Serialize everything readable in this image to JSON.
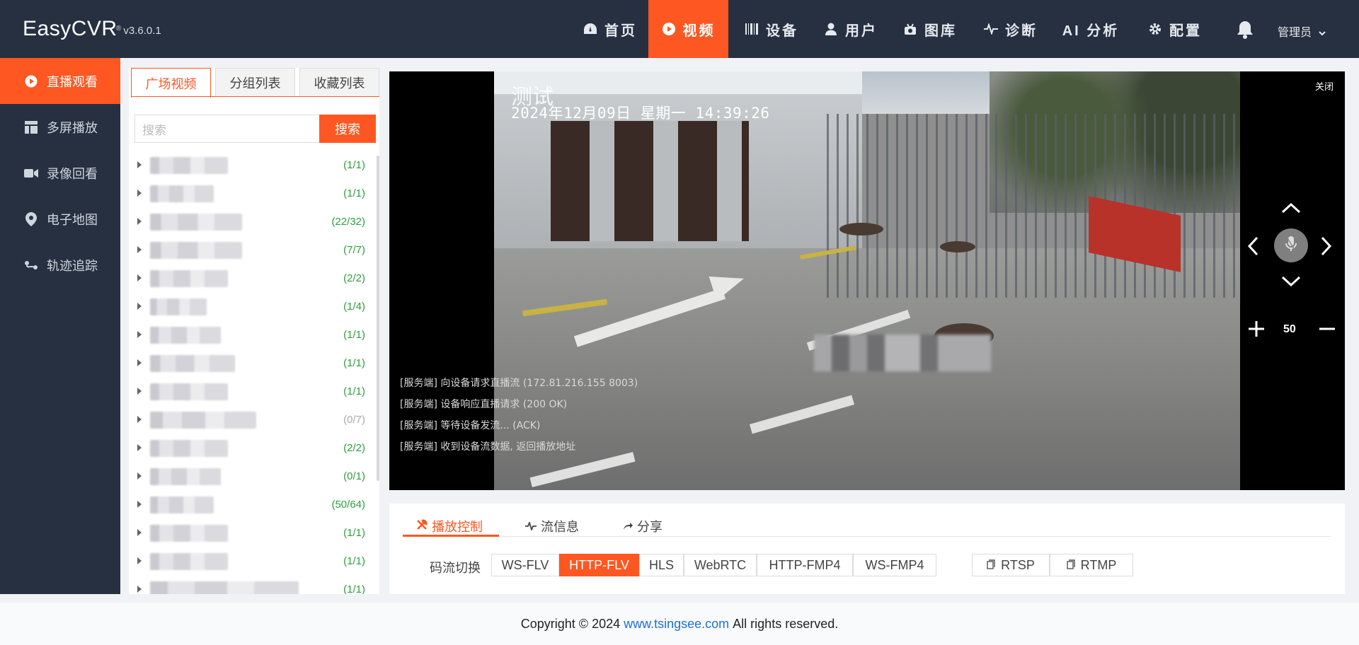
{
  "app": {
    "logo": "EasyCVR",
    "version_mark": "®",
    "version": "v3.6.0.1",
    "colors": {
      "accent": "#ff5722",
      "nav_bg": "#263040",
      "count_green": "#2e9e3e"
    }
  },
  "nav": {
    "items": [
      {
        "label": "首页",
        "icon": "dashboard-icon"
      },
      {
        "label": "视频",
        "icon": "play-circle-icon",
        "active": true
      },
      {
        "label": "设备",
        "icon": "barcode-icon"
      },
      {
        "label": "用户",
        "icon": "user-icon"
      },
      {
        "label": "图库",
        "icon": "camera-icon"
      },
      {
        "label": "诊断",
        "icon": "pulse-icon"
      },
      {
        "label": "AI 分析",
        "icon": ""
      },
      {
        "label": "配置",
        "icon": "gear-icon"
      }
    ],
    "user_label": "管理员"
  },
  "sidebar": {
    "items": [
      {
        "label": "直播观看",
        "icon": "play-circle-icon",
        "active": true
      },
      {
        "label": "多屏播放",
        "icon": "grid-layout-icon"
      },
      {
        "label": "录像回看",
        "icon": "video-camera-icon"
      },
      {
        "label": "电子地图",
        "icon": "map-pin-icon"
      },
      {
        "label": "轨迹追踪",
        "icon": "track-icon"
      }
    ]
  },
  "device_panel": {
    "tabs": [
      "广场视频",
      "分组列表",
      "收藏列表"
    ],
    "search_placeholder": "搜索",
    "search_button": "搜索",
    "tree": [
      {
        "count": "(1/1)"
      },
      {
        "count": "(1/1)"
      },
      {
        "count": "(22/32)"
      },
      {
        "count": "(7/7)"
      },
      {
        "count": "(2/2)"
      },
      {
        "count": "(1/4)"
      },
      {
        "count": "(1/1)"
      },
      {
        "count": "(1/1)"
      },
      {
        "count": "(1/1)"
      },
      {
        "count": "(0/7)",
        "offline": true
      },
      {
        "count": "(2/2)"
      },
      {
        "count": "(0/1)"
      },
      {
        "count": "(50/64)"
      },
      {
        "count": "(1/1)"
      },
      {
        "count": "(1/1)"
      },
      {
        "count": "(1/1)"
      }
    ]
  },
  "player": {
    "osd_title": "测试",
    "osd_time": "2024年12月09日  星期一  14:39:26",
    "close_label": "关闭",
    "zoom_value": "50",
    "logs": [
      "[服务端] 向设备请求直播流  (172.81.216.155 8003)",
      "[服务端] 设备响应直播请求 (200 OK)",
      "[服务端] 等待设备发流... (ACK)",
      "[服务端] 收到设备流数据, 返回播放地址"
    ]
  },
  "control": {
    "tabs": [
      {
        "label": "播放控制",
        "icon": "tools-icon",
        "active": true
      },
      {
        "label": "流信息",
        "icon": "pulse-icon"
      },
      {
        "label": "分享",
        "icon": "share-icon"
      }
    ],
    "stream_label": "码流切换",
    "formats": [
      "WS-FLV",
      "HTTP-FLV",
      "HLS",
      "WebRTC",
      "HTTP-FMP4",
      "WS-FMP4"
    ],
    "active_format": "HTTP-FLV",
    "copy_buttons": [
      "RTSP",
      "RTMP"
    ]
  },
  "footer": {
    "prefix": "Copyright © 2024",
    "link": "www.tsingsee.com",
    "suffix": "All rights reserved."
  }
}
